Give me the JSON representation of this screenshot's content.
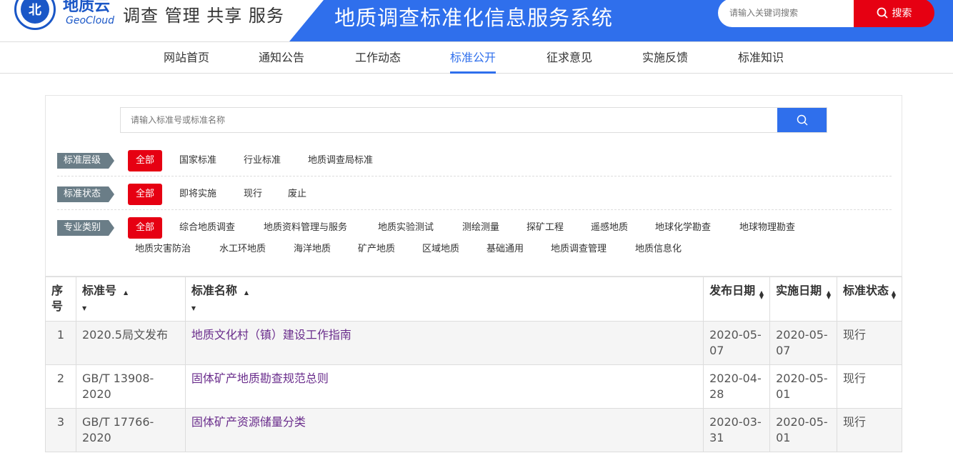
{
  "header": {
    "logo_text": "北",
    "brand_cn": "地质云",
    "brand_en": "GeoCloud",
    "slogan": "调查 管理 共享 服务",
    "system_title": "地质调查标准化信息服务系统",
    "search_placeholder": "请输入关键词搜索",
    "search_button": "搜索"
  },
  "nav": {
    "items": [
      {
        "label": "网站首页"
      },
      {
        "label": "通知公告"
      },
      {
        "label": "工作动态"
      },
      {
        "label": "标准公开"
      },
      {
        "label": "征求意见"
      },
      {
        "label": "实施反馈"
      },
      {
        "label": "标准知识"
      }
    ]
  },
  "filter": {
    "search_placeholder": "请输入标准号或标准名称",
    "level": {
      "tag": "标准层级",
      "options": [
        "全部",
        "国家标准",
        "行业标准",
        "地质调查局标准"
      ]
    },
    "status": {
      "tag": "标准状态",
      "options": [
        "全部",
        "即将实施",
        "现行",
        "废止"
      ]
    },
    "category": {
      "tag": "专业类别",
      "options": [
        "全部",
        "综合地质调查",
        "地质资料管理与服务",
        "地质实验测试",
        "测绘测量",
        "探矿工程",
        "遥感地质",
        "地球化学勘查",
        "地球物理勘查",
        "地质灾害防治",
        "水工环地质",
        "海洋地质",
        "矿产地质",
        "区域地质",
        "基础通用",
        "地质调查管理",
        "地质信息化"
      ]
    }
  },
  "table": {
    "headers": {
      "no": "序号",
      "code": "标准号",
      "name": "标准名称",
      "publish": "发布日期",
      "effective": "实施日期",
      "status": "标准状态"
    },
    "rows": [
      {
        "no": "1",
        "code": "2020.5局文发布",
        "name": "地质文化村（镇）建设工作指南",
        "publish": "2020-05-07",
        "effective": "2020-05-07",
        "status": "现行"
      },
      {
        "no": "2",
        "code": "GB/T 13908-2020",
        "name": "固体矿产地质勘查规范总则",
        "publish": "2020-04-28",
        "effective": "2020-05-01",
        "status": "现行"
      },
      {
        "no": "3",
        "code": "GB/T 17766-2020",
        "name": "固体矿产资源储量分类",
        "publish": "2020-03-31",
        "effective": "2020-05-01",
        "status": "现行"
      }
    ]
  }
}
